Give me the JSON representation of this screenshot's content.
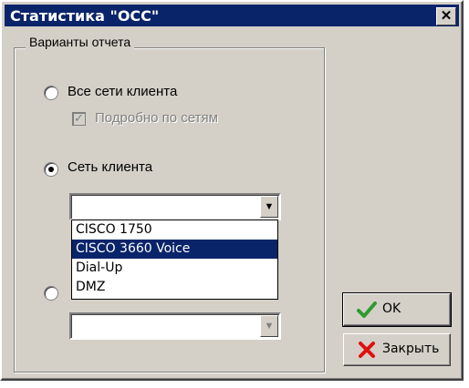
{
  "window": {
    "title": "Статистика \"ОСС\"",
    "close_symbol": "✕"
  },
  "group": {
    "title": "Варианты отчета",
    "all_networks": {
      "label": "Все сети клиента",
      "selected": false
    },
    "detailed_by_networks": {
      "label": "Подробно по сетям",
      "checked": true,
      "enabled": false,
      "check_mark": "✓"
    },
    "client_network": {
      "label": "Сеть клиента",
      "selected": true
    },
    "network_combo": {
      "value": "",
      "arrow": "▼"
    },
    "third_radio": {
      "label": "",
      "selected": false
    },
    "third_combo": {
      "value": "",
      "arrow": "▼",
      "enabled": false
    }
  },
  "dropdown": {
    "items": [
      "CISCO 1750",
      "CISCO 3660 Voice",
      "Dial-Up",
      "DMZ"
    ],
    "selected_index": 1
  },
  "buttons": {
    "ok": {
      "label": "OK",
      "icon": "checkmark-icon",
      "icon_color": "#2e9b2e"
    },
    "close": {
      "label": "Закрыть",
      "icon": "red-x-icon",
      "icon_color": "#e01010"
    }
  }
}
